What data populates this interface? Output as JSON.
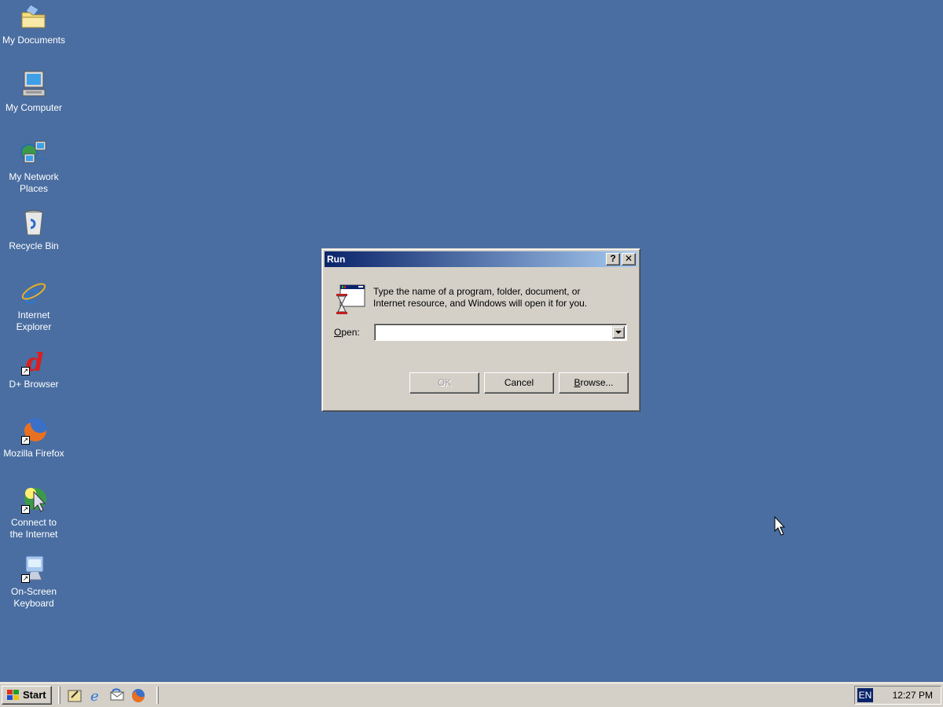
{
  "desktop": {
    "background_color": "#4a6ea1",
    "icons": [
      {
        "label_lines": [
          "My Documents"
        ],
        "icon": "folder-documents-icon",
        "shortcut": false
      },
      {
        "label_lines": [
          "My Computer"
        ],
        "icon": "computer-icon",
        "shortcut": false
      },
      {
        "label_lines": [
          "My Network",
          "Places"
        ],
        "icon": "network-icon",
        "shortcut": false
      },
      {
        "label_lines": [
          "Recycle Bin"
        ],
        "icon": "recycle-bin-icon",
        "shortcut": false
      },
      {
        "label_lines": [
          "Internet",
          "Explorer"
        ],
        "icon": "internet-explorer-icon",
        "shortcut": false
      },
      {
        "label_lines": [
          "D+ Browser"
        ],
        "icon": "d-plus-browser-icon",
        "shortcut": true
      },
      {
        "label_lines": [
          "Mozilla Firefox"
        ],
        "icon": "firefox-icon",
        "shortcut": true
      },
      {
        "label_lines": [
          "Connect to",
          "the Internet"
        ],
        "icon": "connect-internet-icon",
        "shortcut": true
      },
      {
        "label_lines": [
          "On-Screen",
          "Keyboard"
        ],
        "icon": "onscreen-keyboard-icon",
        "shortcut": true
      }
    ]
  },
  "dialog": {
    "title": "Run",
    "help_button": "?",
    "close_button": "✕",
    "description_line1": "Type the name of a program, folder, document, or",
    "description_line2": "Internet resource, and Windows will open it for you.",
    "open_label_mnemonic": "O",
    "open_label_rest": "pen:",
    "open_value": "",
    "buttons": {
      "ok": "OK",
      "cancel": "Cancel",
      "browse_mnemonic": "B",
      "browse_rest": "rowse..."
    },
    "ok_enabled": false
  },
  "taskbar": {
    "start_label": "Start",
    "quick_launch": [
      "show-desktop-icon",
      "internet-explorer-icon",
      "outlook-express-icon",
      "firefox-icon"
    ],
    "language": "EN",
    "clock": "12:27 PM"
  }
}
